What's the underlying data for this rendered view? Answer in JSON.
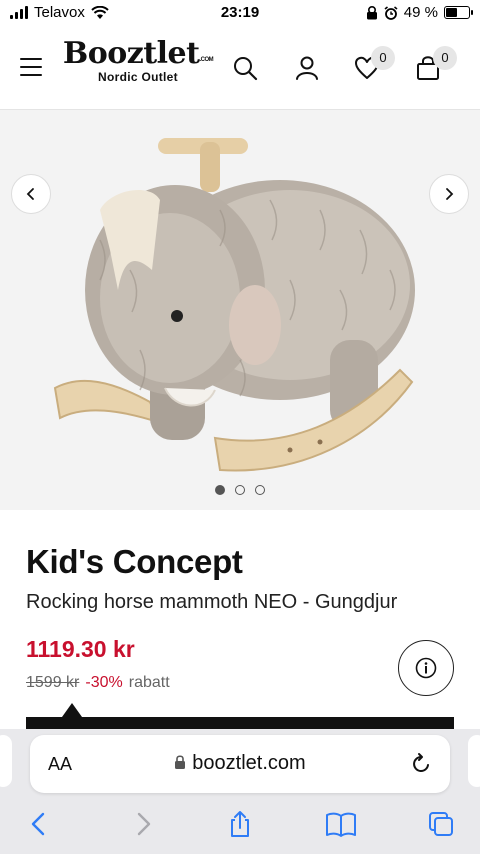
{
  "status_bar": {
    "carrier": "Telavox",
    "time": "23:19",
    "battery": "49 %",
    "battery_level": 0.49
  },
  "header": {
    "logo_text": "Booztlet",
    "logo_suffix": ".COM",
    "logo_tagline": "Nordic Outlet",
    "wishlist_count": "0",
    "cart_count": "0",
    "icons": [
      "menu-icon",
      "search-icon",
      "account-icon",
      "heart-icon",
      "bag-icon"
    ]
  },
  "gallery": {
    "image_alt": "Rocking horse mammoth",
    "total_images": 3,
    "active_index": 0
  },
  "product": {
    "brand": "Kid's Concept",
    "name": "Rocking horse mammoth NEO - Gungdjur",
    "price": "1119.30 kr",
    "original_price": "1599 kr",
    "discount": "-30%",
    "discount_label": "rabatt"
  },
  "browser": {
    "text_size_label": "AA",
    "url": "booztlet.com"
  },
  "colors": {
    "sale_red": "#c8102e",
    "text_dark": "#111111",
    "browser_bg": "#e9e9ec",
    "toolbar_blue": "#2f7cf6"
  }
}
